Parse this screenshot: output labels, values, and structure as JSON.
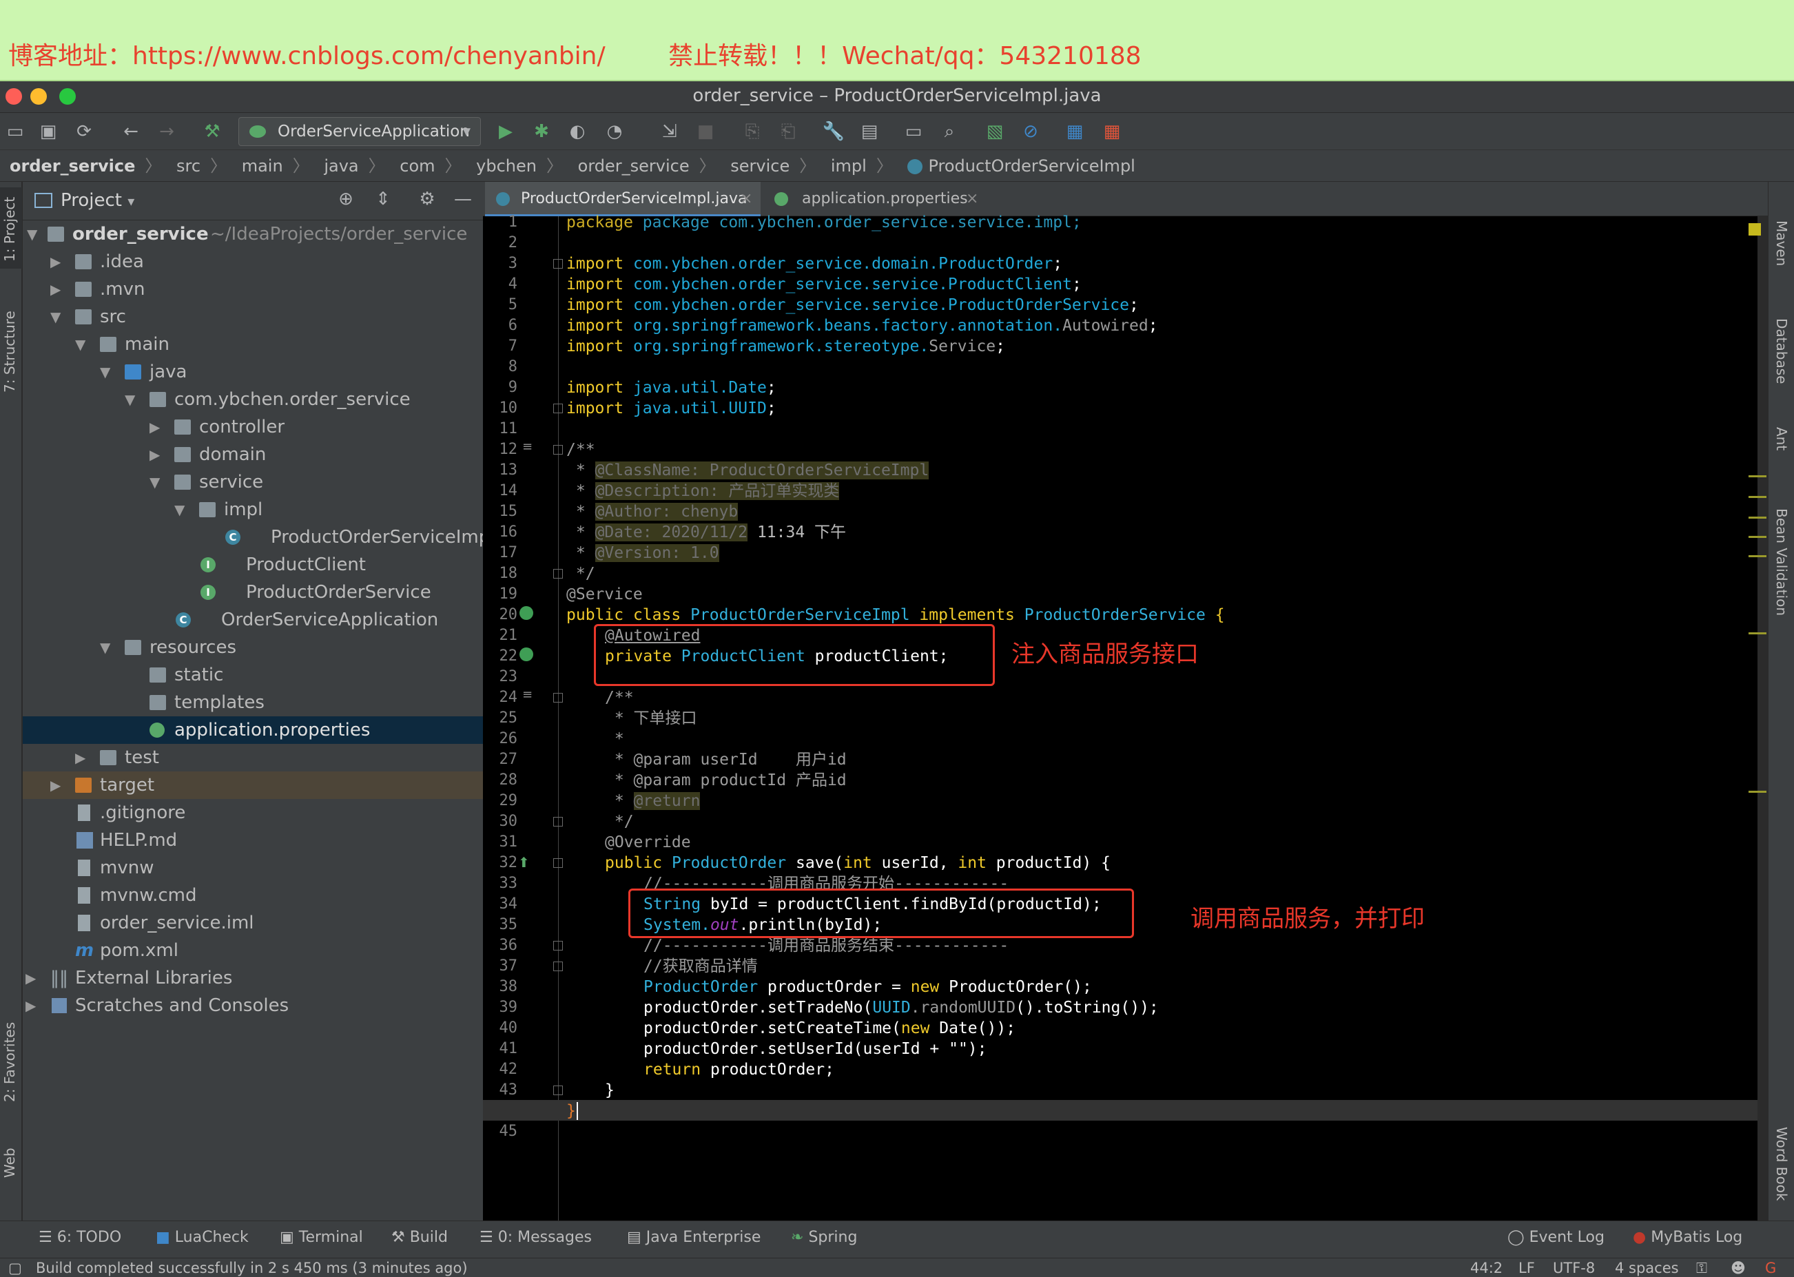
{
  "banner": {
    "text": "博客地址：https://www.cnblogs.com/chenyanbin/        禁止转载！！！Wechat/qq：543210188"
  },
  "window": {
    "title": "order_service – ProductOrderServiceImpl.java"
  },
  "toolbar": {
    "run_config": "OrderServiceApplication"
  },
  "breadcrumb": [
    "order_service",
    "src",
    "main",
    "java",
    "com",
    "ybchen",
    "order_service",
    "service",
    "impl",
    "ProductOrderServiceImpl"
  ],
  "left_stripe": {
    "project": "1: Project",
    "structure": "7: Structure",
    "favorites": "2: Favorites",
    "web": "Web"
  },
  "right_stripe": {
    "maven": "Maven",
    "database": "Database",
    "ant": "Ant",
    "bean_validation": "Bean Validation",
    "word_book": "Word Book"
  },
  "project_panel": {
    "title": "Project",
    "tree": [
      {
        "label": "order_service",
        "path": "~/IdeaProjects/order_service"
      },
      {
        "label": ".idea"
      },
      {
        "label": ".mvn"
      },
      {
        "label": "src"
      },
      {
        "label": "main"
      },
      {
        "label": "java"
      },
      {
        "label": "com.ybchen.order_service"
      },
      {
        "label": "controller"
      },
      {
        "label": "domain"
      },
      {
        "label": "service"
      },
      {
        "label": "impl"
      },
      {
        "label": "ProductOrderServiceImpl"
      },
      {
        "label": "ProductClient"
      },
      {
        "label": "ProductOrderService"
      },
      {
        "label": "OrderServiceApplication"
      },
      {
        "label": "resources"
      },
      {
        "label": "static"
      },
      {
        "label": "templates"
      },
      {
        "label": "application.properties"
      },
      {
        "label": "test"
      },
      {
        "label": "target"
      },
      {
        "label": ".gitignore"
      },
      {
        "label": "HELP.md"
      },
      {
        "label": "mvnw"
      },
      {
        "label": "mvnw.cmd"
      },
      {
        "label": "order_service.iml"
      },
      {
        "label": "pom.xml"
      },
      {
        "label": "External Libraries"
      },
      {
        "label": "Scratches and Consoles"
      }
    ]
  },
  "editor": {
    "tabs": [
      {
        "label": "ProductOrderServiceImpl.java"
      },
      {
        "label": "application.properties"
      }
    ],
    "line_numbers": [
      "1",
      "2",
      "3",
      "4",
      "5",
      "6",
      "7",
      "8",
      "9",
      "10",
      "11",
      "12",
      "13",
      "14",
      "15",
      "16",
      "17",
      "18",
      "19",
      "20",
      "21",
      "22",
      "23",
      "24",
      "25",
      "26",
      "27",
      "28",
      "29",
      "30",
      "31",
      "32",
      "33",
      "34",
      "35",
      "36",
      "37",
      "38",
      "39",
      "40",
      "41",
      "42",
      "43",
      "",
      "45"
    ],
    "code": {
      "l1": "package com.ybchen.order_service.service.impl;",
      "l3": "com.ybchen.order_service.domain.ProductOrder",
      "l4": "com.ybchen.order_service.service.ProductClient",
      "l5": "com.ybchen.order_service.service.ProductOrderService",
      "l6a": "org.springframework.beans.factory.annotation.",
      "l6b": "Autowired",
      "l7a": "org.springframework.stereotype.",
      "l7b": "Service",
      "l9": "java.util.Date",
      "l10": "java.util.UUID",
      "l12": "/**",
      "l13": "@ClassName: ProductOrderServiceImpl",
      "l14": "@Description: 产品订单实现类",
      "l15": "@Author: chenyb",
      "l16a": "@Date: 2020/11/2",
      "l16b": " 11:34 下午",
      "l17": "@Version: 1.0",
      "l18": " */",
      "l19": "@Service",
      "l20a": "ProductOrderServiceImpl",
      "l20b": "ProductOrderService",
      "l21": "@Autowired",
      "l22a": "ProductClient",
      "l22b": " productClient;",
      "l24": "/**",
      "l25": " * 下单接口",
      "l26": " *",
      "l27": " * @param userId    用户id",
      "l28": " * @param productId 产品id",
      "l29": "@return",
      "l30": " */",
      "l31": "@Override",
      "l32a": "ProductOrder",
      "l32b": " save(",
      "l32c": " userId, ",
      "l32d": " productId) {",
      "l33": "//-----------调用商品服务开始------------",
      "l34a": "String",
      "l34b": " byId = productClient.findById(productId);",
      "l35a": "System.",
      "l35b": "out",
      "l35c": ".println(byId);",
      "l36": "//-----------调用商品服务结束------------",
      "l37": "//获取商品详情",
      "l38a": "ProductOrder",
      "l38b": " productOrder = ",
      "l38c": " ProductOrder();",
      "l39a": "productOrder.setTradeNo(",
      "l39b": "UUID",
      "l39c": ".randomUUID",
      "l39d": "().toString());",
      "l40a": "productOrder.setCreateTime(",
      "l40b": " Date());",
      "l41": "productOrder.setUserId(userId + \"\");",
      "l42a": "return",
      "l42b": " productOrder;",
      "l43": "}",
      "l44": "}"
    },
    "keywords": {
      "package": "package",
      "import": "import",
      "public": "public",
      "class": "class",
      "implements": "implements",
      "private": "private",
      "int": "int",
      "new": "new"
    }
  },
  "annotations": {
    "note1": "注入商品服务接口",
    "note2": "调用商品服务，并打印"
  },
  "bottom_tools": [
    "6: TODO",
    "LuaCheck",
    "Terminal",
    "Build",
    "0: Messages",
    "Java Enterprise",
    "Spring",
    "Event Log",
    "MyBatis Log"
  ],
  "status": {
    "message": "Build completed successfully in 2 s 450 ms (3 minutes ago)",
    "position": "44:2",
    "line_sep": "LF",
    "encoding": "UTF-8",
    "indent": "4 spaces"
  },
  "colors": {
    "banner_bg": "#ccf6b0",
    "banner_text": "#e8422e",
    "annotation_red": "#e8372a",
    "keyword": "#f0ca2b",
    "package_blue": "#21a8d8"
  }
}
